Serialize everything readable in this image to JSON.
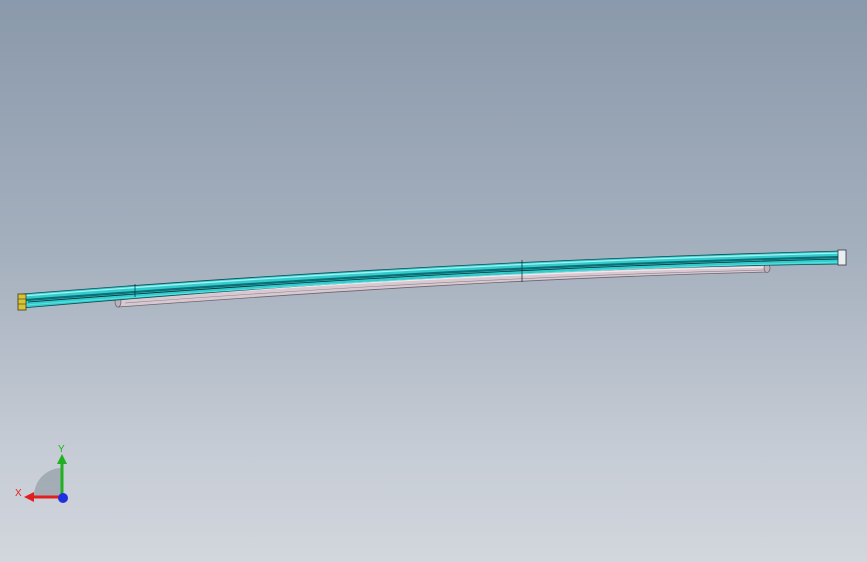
{
  "viewport": {
    "background_top": "#8a99ab",
    "background_bottom": "#d2d6dd"
  },
  "model": {
    "upper_bar_color": "#33cccc",
    "upper_bar_dark": "#0e6f78",
    "lower_bar_color": "#d8c8d0",
    "lower_bar_edge": "#6b6470",
    "end_cap_color": "#e8d84a"
  },
  "triad": {
    "x_label": "X",
    "y_label": "Y",
    "x_color": "#e02020",
    "y_color": "#20b020",
    "z_color": "#2030e0"
  }
}
